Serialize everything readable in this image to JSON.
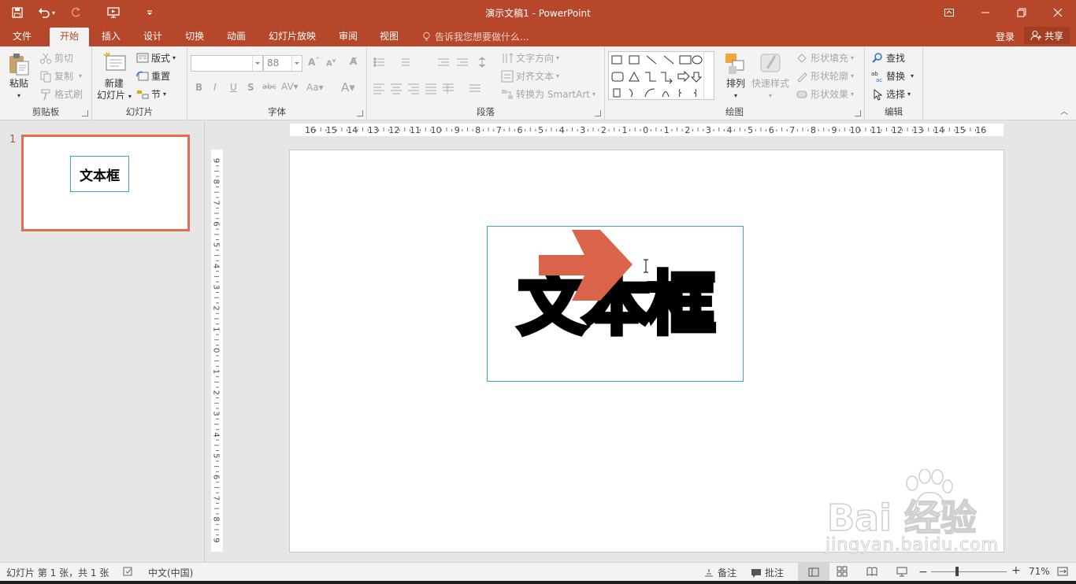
{
  "window": {
    "title": "演示文稿1 - PowerPoint"
  },
  "tabs": [
    "文件",
    "开始",
    "插入",
    "设计",
    "切换",
    "动画",
    "幻灯片放映",
    "审阅",
    "视图"
  ],
  "active_tab": "开始",
  "tell_me": "告诉我您想要做什么...",
  "account": {
    "login": "登录",
    "share": "共享"
  },
  "ribbon": {
    "clipboard": {
      "label": "剪贴板",
      "paste": "粘贴",
      "cut": "剪切",
      "copy": "复制",
      "format_painter": "格式刷"
    },
    "slides": {
      "label": "幻灯片",
      "new_slide_line1": "新建",
      "new_slide_line2": "幻灯片",
      "layout": "版式",
      "reset": "重置",
      "section": "节"
    },
    "font": {
      "label": "字体",
      "font_size": "88"
    },
    "paragraph": {
      "label": "段落",
      "text_direction": "文字方向",
      "align_text": "对齐文本",
      "convert_smartart": "转换为 SmartArt"
    },
    "drawing": {
      "label": "绘图",
      "arrange": "排列",
      "quick_styles": "快速样式",
      "shape_fill": "形状填充",
      "shape_outline": "形状轮廓",
      "shape_effects": "形状效果"
    },
    "editing": {
      "label": "编辑",
      "find": "查找",
      "replace": "替换",
      "select": "选择"
    }
  },
  "ruler": {
    "h_ticks": [
      "16",
      "15",
      "14",
      "13",
      "12",
      "11",
      "10",
      "9",
      "8",
      "7",
      "6",
      "5",
      "4",
      "3",
      "2",
      "1",
      "0",
      "1",
      "2",
      "3",
      "4",
      "5",
      "6",
      "7",
      "8",
      "9",
      "10",
      "11",
      "12",
      "13",
      "14",
      "15",
      "16"
    ],
    "v_ticks": [
      "9",
      "8",
      "7",
      "6",
      "5",
      "4",
      "3",
      "2",
      "1",
      "0",
      "1",
      "2",
      "3",
      "4",
      "5",
      "6",
      "7",
      "8",
      "9"
    ]
  },
  "slides": [
    {
      "number": "1",
      "text": "文本框"
    }
  ],
  "slide": {
    "textbox_text": "文本框"
  },
  "watermark": {
    "main": "Bai  经验",
    "url": "jingyan.baidu.com"
  },
  "status": {
    "slide_info": "幻灯片 第 1 张，共 1 张",
    "language": "中文(中国)",
    "notes": "备注",
    "comments": "批注",
    "zoom": "71%"
  },
  "colors": {
    "accent": "#b7472a",
    "arrow": "#d9644a",
    "selection": "#3aa3cf"
  }
}
